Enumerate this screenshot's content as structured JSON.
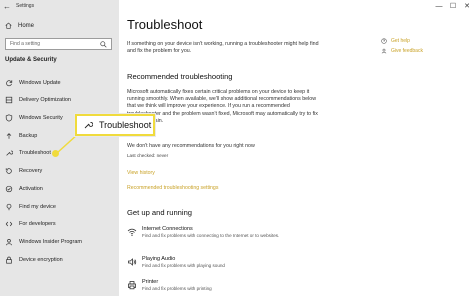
{
  "window": {
    "title": "Settings",
    "back_glyph": "←",
    "minimize_glyph": "—",
    "maximize_glyph": "☐",
    "close_glyph": "✕"
  },
  "sidebar": {
    "home_label": "Home",
    "search_placeholder": "Find a setting",
    "section_title": "Update & Security",
    "items": [
      {
        "label": "Windows Update",
        "icon": "sync-icon"
      },
      {
        "label": "Delivery Optimization",
        "icon": "delivery-icon"
      },
      {
        "label": "Windows Security",
        "icon": "shield-icon"
      },
      {
        "label": "Backup",
        "icon": "backup-icon"
      },
      {
        "label": "Troubleshoot",
        "icon": "wrench-icon"
      },
      {
        "label": "Recovery",
        "icon": "recovery-icon"
      },
      {
        "label": "Activation",
        "icon": "activation-icon"
      },
      {
        "label": "Find my device",
        "icon": "find-device-icon"
      },
      {
        "label": "For developers",
        "icon": "developers-icon"
      },
      {
        "label": "Windows Insider Program",
        "icon": "insider-icon"
      },
      {
        "label": "Device encryption",
        "icon": "lock-icon"
      }
    ]
  },
  "main": {
    "title": "Troubleshoot",
    "intro": "If something on your device isn't working, running a troubleshooter might help find and fix the problem for you.",
    "recommended_heading": "Recommended troubleshooting",
    "recommended_body": "Microsoft automatically fixes certain critical problems on your device to keep it running smoothly. When available, we'll show additional recommendations below that we think will improve your experience. If you run a recommended troubleshooter and the problem wasn't fixed, Microsoft may automatically try to fix it for you again.",
    "no_recommendations": "We don't have any recommendations for you right now",
    "last_checked": "Last checked: never",
    "view_history": "View history",
    "recommended_settings": "Recommended troubleshooting settings",
    "get_up_heading": "Get up and running",
    "troubleshooters": [
      {
        "title": "Internet Connections",
        "desc": "Find and fix problems with connecting to the Internet or to websites.",
        "icon": "wifi-icon"
      },
      {
        "title": "Playing Audio",
        "desc": "Find and fix problems with playing sound",
        "icon": "speaker-icon"
      },
      {
        "title": "Printer",
        "desc": "Find and fix problems with printing",
        "icon": "printer-icon"
      }
    ],
    "help_links": {
      "get_help": "Get help",
      "give_feedback": "Give feedback"
    }
  },
  "callout": {
    "label": "Troubleshoot",
    "accent_color": "#f0db3c"
  }
}
